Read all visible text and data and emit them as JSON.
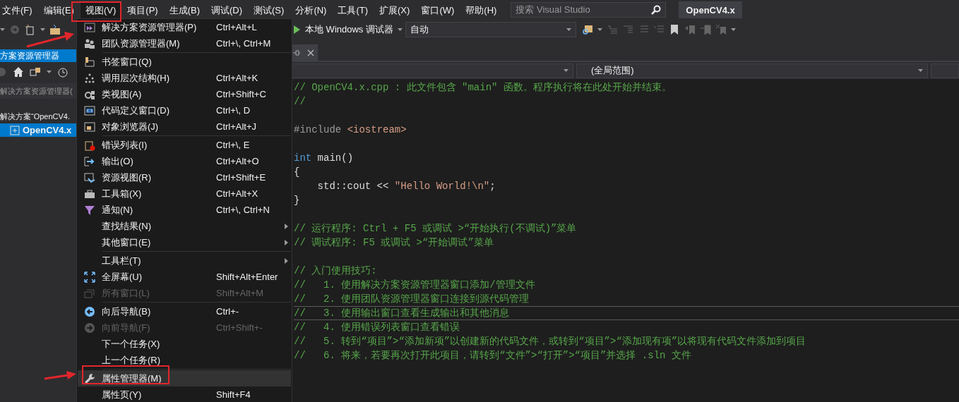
{
  "menubar": {
    "items": [
      {
        "label": "文件(F)",
        "selected": false
      },
      {
        "label": "编辑(E)",
        "selected": false
      },
      {
        "label": "视图(V)",
        "selected": true
      },
      {
        "label": "项目(P)",
        "selected": false
      },
      {
        "label": "生成(B)",
        "selected": false
      },
      {
        "label": "调试(D)",
        "selected": false
      },
      {
        "label": "测试(S)",
        "selected": false
      },
      {
        "label": "分析(N)",
        "selected": false
      },
      {
        "label": "工具(T)",
        "selected": false
      },
      {
        "label": "扩展(X)",
        "selected": false
      },
      {
        "label": "窗口(W)",
        "selected": false
      },
      {
        "label": "帮助(H)",
        "selected": false
      }
    ],
    "search": {
      "placeholder": "搜索 Visual Studio"
    },
    "solution_title": "OpenCV4.x"
  },
  "toolbar": {
    "debugger": "本地 Windows 调试器",
    "configuration": "自动"
  },
  "solution_explorer": {
    "title": "方案资源管理器",
    "search": {
      "placeholder": "解决方案资源管理器("
    },
    "tree": [
      {
        "label": "解决方案“OpenCV4.",
        "selected": false,
        "children": [
          {
            "label": "OpenCV4.x",
            "selected": true
          }
        ]
      }
    ]
  },
  "editor": {
    "scope": "(全局范围)",
    "code_blocks": [
      [
        {
          "current": false,
          "segments": [
            {
              "kind": "comment",
              "text": "// OpenCV4.x.cpp : 此文件包含 \"main\" 函数。程序执行将在此处开始并结束。"
            }
          ]
        },
        {
          "current": false,
          "segments": [
            {
              "kind": "comment",
              "text": "//"
            }
          ]
        }
      ],
      [
        {
          "current": false,
          "segments": [
            {
              "kind": "preprocessor",
              "text": "#include "
            },
            {
              "kind": "string",
              "text": "<iostream>"
            }
          ]
        }
      ],
      [
        {
          "current": false,
          "segments": [
            {
              "kind": "keyword",
              "text": "int"
            },
            {
              "kind": "plain",
              "text": " main()"
            }
          ]
        },
        {
          "current": false,
          "segments": [
            {
              "kind": "plain",
              "text": "{"
            }
          ]
        },
        {
          "current": false,
          "segments": [
            {
              "kind": "plain",
              "text": "    std::cout << "
            },
            {
              "kind": "string",
              "text": "\"Hello World!\\n\""
            },
            {
              "kind": "plain",
              "text": ";"
            }
          ]
        },
        {
          "current": false,
          "segments": [
            {
              "kind": "plain",
              "text": "}"
            }
          ]
        }
      ],
      [
        {
          "current": false,
          "segments": [
            {
              "kind": "comment",
              "text": "// 运行程序: Ctrl + F5 或调试 >“开始执行(不调试)”菜单"
            }
          ]
        },
        {
          "current": false,
          "segments": [
            {
              "kind": "comment",
              "text": "// 调试程序: F5 或调试 >“开始调试”菜单"
            }
          ]
        }
      ],
      [
        {
          "current": false,
          "segments": [
            {
              "kind": "comment",
              "text": "// 入门使用技巧: "
            }
          ]
        },
        {
          "current": false,
          "segments": [
            {
              "kind": "comment",
              "text": "//   1. 使用解决方案资源管理器窗口添加/管理文件"
            }
          ]
        },
        {
          "current": false,
          "segments": [
            {
              "kind": "comment",
              "text": "//   2. 使用团队资源管理器窗口连接到源代码管理"
            }
          ]
        },
        {
          "current": true,
          "segments": [
            {
              "kind": "comment",
              "text": "//   3. 使用输出窗口查看生成输出和其他消息"
            }
          ]
        },
        {
          "current": false,
          "segments": [
            {
              "kind": "comment",
              "text": "//   4. 使用错误列表窗口查看错误"
            }
          ]
        },
        {
          "current": false,
          "segments": [
            {
              "kind": "comment",
              "text": "//   5. 转到“项目”>“添加新项”以创建新的代码文件，或转到“项目”>“添加现有项”以将现有代码文件添加到项目"
            }
          ]
        },
        {
          "current": false,
          "segments": [
            {
              "kind": "comment",
              "text": "//   6. 将来，若要再次打开此项目，请转到“文件”>“打开”>“项目”并选择 .sln 文件"
            }
          ]
        }
      ]
    ]
  },
  "view_menu": {
    "items": [
      {
        "kind": "item",
        "label": "解决方案资源管理器(P)",
        "shortcut": "Ctrl+Alt+L",
        "disabled": false,
        "selected": false
      },
      {
        "kind": "item",
        "label": "团队资源管理器(M)",
        "shortcut": "Ctrl+\\, Ctrl+M",
        "disabled": false,
        "selected": false
      },
      {
        "kind": "separator"
      },
      {
        "kind": "item",
        "label": "书签窗口(Q)",
        "disabled": false,
        "selected": false
      },
      {
        "kind": "item",
        "label": "调用层次结构(H)",
        "shortcut": "Ctrl+Alt+K",
        "disabled": false,
        "selected": false
      },
      {
        "kind": "item",
        "label": "类视图(A)",
        "shortcut": "Ctrl+Shift+C",
        "disabled": false,
        "selected": false
      },
      {
        "kind": "item",
        "label": "代码定义窗口(D)",
        "shortcut": "Ctrl+\\, D",
        "disabled": false,
        "selected": false
      },
      {
        "kind": "item",
        "label": "对象浏览器(J)",
        "shortcut": "Ctrl+Alt+J",
        "disabled": false,
        "selected": false
      },
      {
        "kind": "separator"
      },
      {
        "kind": "item",
        "label": "错误列表(I)",
        "shortcut": "Ctrl+\\, E",
        "disabled": false,
        "selected": false
      },
      {
        "kind": "item",
        "label": "输出(O)",
        "shortcut": "Ctrl+Alt+O",
        "disabled": false,
        "selected": false
      },
      {
        "kind": "item",
        "label": "资源视图(R)",
        "shortcut": "Ctrl+Shift+E",
        "disabled": false,
        "selected": false
      },
      {
        "kind": "item",
        "label": "工具箱(X)",
        "shortcut": "Ctrl+Alt+X",
        "disabled": false,
        "selected": false
      },
      {
        "kind": "item",
        "label": "通知(N)",
        "shortcut": "Ctrl+\\, Ctrl+N",
        "disabled": false,
        "selected": false
      },
      {
        "kind": "submenu",
        "label": "查找结果(N)",
        "disabled": false,
        "selected": false
      },
      {
        "kind": "submenu",
        "label": "其他窗口(E)",
        "disabled": false,
        "selected": false
      },
      {
        "kind": "separator"
      },
      {
        "kind": "submenu",
        "label": "工具栏(T)",
        "disabled": false,
        "selected": false
      },
      {
        "kind": "item",
        "label": "全屏幕(U)",
        "shortcut": "Shift+Alt+Enter",
        "disabled": false,
        "selected": false
      },
      {
        "kind": "item",
        "label": "所有窗口(L)",
        "shortcut": "Shift+Alt+M",
        "disabled": true,
        "selected": false
      },
      {
        "kind": "separator"
      },
      {
        "kind": "item",
        "label": "向后导航(B)",
        "shortcut": "Ctrl+-",
        "disabled": false,
        "selected": false
      },
      {
        "kind": "item",
        "label": "向前导航(F)",
        "shortcut": "Ctrl+Shift+-",
        "disabled": true,
        "selected": false
      },
      {
        "kind": "item",
        "label": "下一个任务(X)",
        "disabled": false,
        "selected": false
      },
      {
        "kind": "item",
        "label": "上一个任务(R)",
        "disabled": false,
        "selected": false
      },
      {
        "kind": "separator"
      },
      {
        "kind": "item",
        "label": "属性管理器(M)",
        "disabled": false,
        "selected": true
      },
      {
        "kind": "item",
        "label": "属性页(Y)",
        "shortcut": "Shift+F4",
        "disabled": false,
        "selected": false
      }
    ]
  }
}
